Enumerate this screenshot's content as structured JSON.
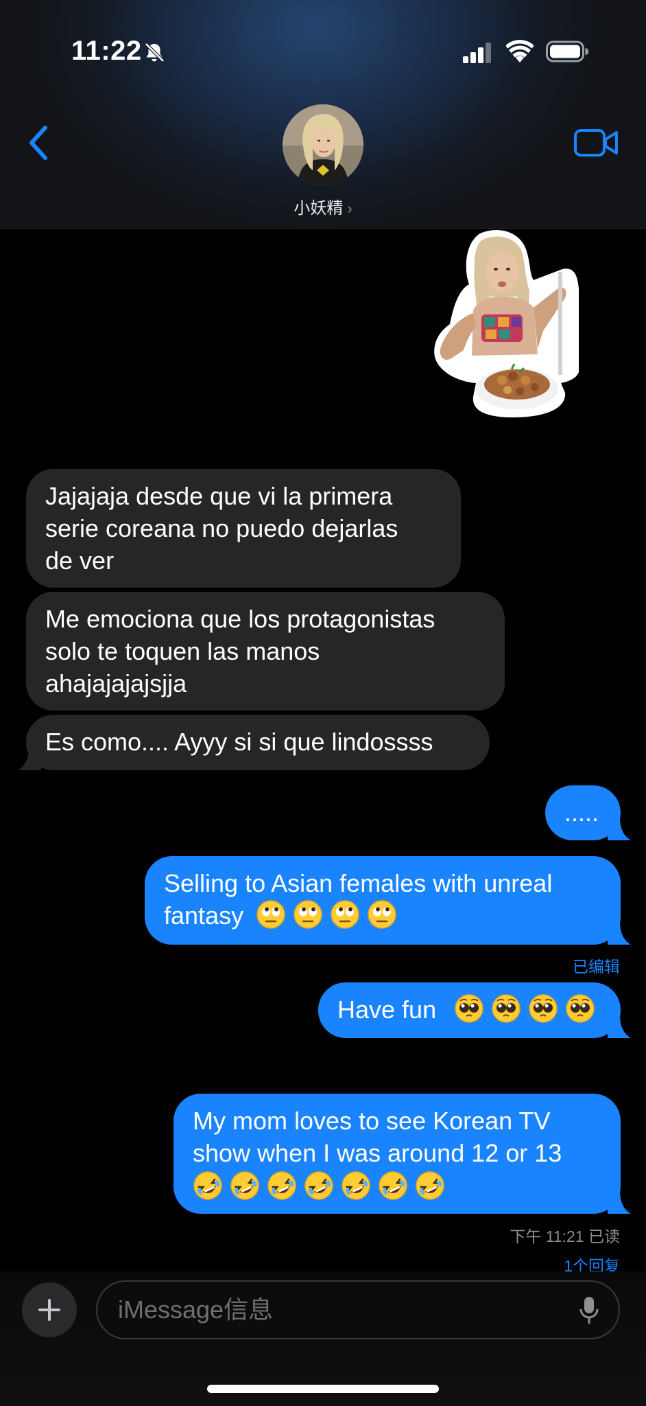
{
  "status_bar": {
    "time": "11:22",
    "icons": [
      "bell-slash-icon",
      "cellular-signal-icon",
      "wifi-icon",
      "battery-icon"
    ]
  },
  "header": {
    "contact_name": "小妖精",
    "chevron": "›",
    "icons": [
      "back-chevron-icon",
      "video-camera-icon"
    ]
  },
  "messages": [
    {
      "direction": "incoming",
      "lines": [
        "Jajajaja desde que vi la primera",
        "serie coreana no puedo dejarlas",
        "de ver"
      ]
    },
    {
      "direction": "incoming",
      "lines": [
        "Me emociona que los protagonistas",
        "solo te toquen las manos",
        "ahajajajajsjja"
      ]
    },
    {
      "direction": "incoming",
      "lines": [
        "Es como.... Ayyy si si que lindossss"
      ]
    },
    {
      "direction": "outgoing",
      "text": "....."
    },
    {
      "direction": "outgoing",
      "line1": "Selling to Asian females with unreal",
      "line2": "fantasy",
      "emoji": "face-with-rolling-eyes",
      "emoji_count": 4,
      "note": "已编辑"
    },
    {
      "direction": "outgoing",
      "text": "Have fun",
      "emoji": "pleading-face",
      "emoji_count": 4
    },
    {
      "direction": "outgoing",
      "line1": "My mom loves to see Korean TV",
      "line2": "show when I was around 12 or 13",
      "emoji": "rolling-on-the-floor-laughing",
      "emoji_count": 7
    }
  ],
  "read_receipt": "下午 11:21 已读",
  "reply_count": "1个回复",
  "composer": {
    "placeholder": "iMessage信息",
    "icons": [
      "plus-icon",
      "microphone-icon"
    ]
  },
  "colors": {
    "outgoing_bubble": "#1a84ff",
    "incoming_bubble": "#262629",
    "accent": "#1a84ff"
  }
}
